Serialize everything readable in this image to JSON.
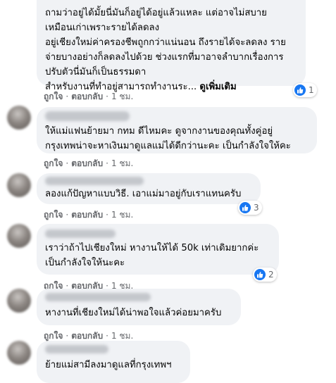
{
  "comments": [
    {
      "lines": [
        "ถามว่าอยู่ได้มั้ยนี่มันก็อยู่ได้อยู่แล้วแหละ แต่อาจไม่สบาย",
        "เหมือนเก่าเพราะรายได้ลดลง",
        "อยู่เชียงใหม่ค่าครองชีพถูกกว่าแน่นอน ถึงรายได้จะลดลง ราย",
        "จ่ายบางอย่างก็ลดลงไปด้วย ช่วงแรกที่มาอาจลำบากเรื่องการ",
        "ปรับตัวนี่มันก็เป็นธรรมดา",
        "สำหรับงานที่ทำอยู่สามารถทำงานระ..."
      ],
      "see_more": "ดูเพิ่มเติม",
      "like": "ถูกใจ",
      "reply": "ตอบกลับ",
      "time": "1 ชม.",
      "reactions": "1"
    },
    {
      "lines": [
        "ให้แม่แฟนย้ายมา กทม ดีไหมคะ ดูจากงานของคุณทั้งคู่อยู่",
        "กรุงเทพน่าจะหาเงินมาดูแลแม่ได้ดีกว่านะคะ เป็นกำลังใจให้คะ"
      ],
      "like": "ถูกใจ",
      "reply": "ตอบกลับ",
      "time": "1 ชม."
    },
    {
      "lines": [
        "ลองแก้ปัญหาแบบวิธี. เอาแม่มาอยู่กับเราแทนครับ"
      ],
      "like": "ถูกใจ",
      "reply": "ตอบกลับ",
      "time": "1 ชม.",
      "reactions": "3"
    },
    {
      "lines": [
        "เราว่าถ้าไปเชียงใหม่ หางานให้ได้ 50k เท่าเดิมยากค่ะ",
        "เป็นกำลังใจให้นะคะ"
      ],
      "like": "ถูกใจ",
      "reply": "ตอบกลับ",
      "time": "1 ชม.",
      "reactions": "2"
    },
    {
      "lines": [
        "หางานที่เชียงใหม่ได้น่าพอใจแล้วค่อยมาครับ"
      ],
      "like": "ถูกใจ",
      "reply": "ตอบกลับ",
      "time": "1 ชม."
    },
    {
      "lines": [
        "ย้ายแม่สามีลงมาดูแลที่กรุงเทพฯ"
      ]
    }
  ],
  "colors": {
    "bubble": "#f0f2f5",
    "like_blue": "#1877f2",
    "meta_gray": "#65676b"
  }
}
